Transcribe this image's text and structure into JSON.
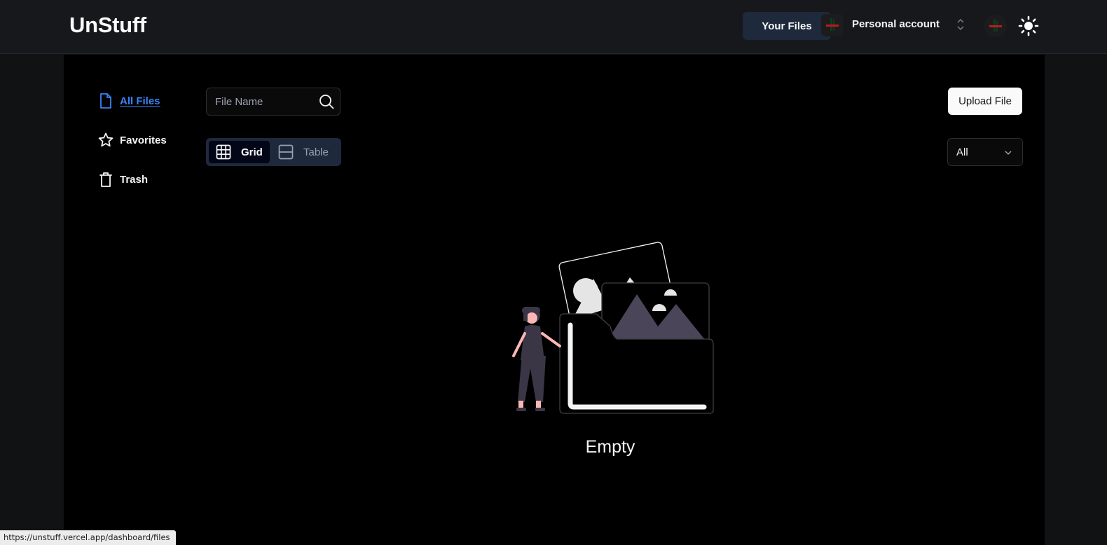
{
  "header": {
    "brand": "UnStuff",
    "your_files_label": "Your Files",
    "account_name": "Personal account"
  },
  "sidebar": {
    "items": [
      {
        "label": "All Files",
        "icon": "file-icon",
        "active": true
      },
      {
        "label": "Favorites",
        "icon": "star-icon",
        "active": false
      },
      {
        "label": "Trash",
        "icon": "trash-icon",
        "active": false
      }
    ]
  },
  "search": {
    "placeholder": "File Name",
    "value": ""
  },
  "view_toggle": {
    "grid_label": "Grid",
    "table_label": "Table",
    "selected": "Grid"
  },
  "upload_label": "Upload File",
  "filter": {
    "selected": "All"
  },
  "empty_state": {
    "text": "Empty"
  },
  "status_bar": {
    "url": "https://unstuff.vercel.app/dashboard/files"
  },
  "colors": {
    "accent": "#3b82f6",
    "background": "#000000",
    "header": "#17181b",
    "toggle_bg": "#1e293b"
  }
}
